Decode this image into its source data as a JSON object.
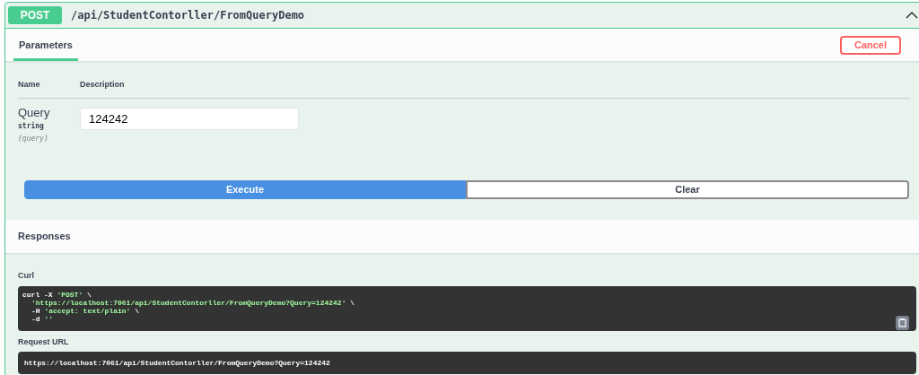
{
  "operation": {
    "method": "POST",
    "path": "/api/StudentContorller/FromQueryDemo",
    "expanded": true
  },
  "tabs": [
    {
      "label": "Parameters",
      "selected": true
    }
  ],
  "cancel_button": "Cancel",
  "parameters_table": {
    "columns": [
      "Name",
      "Description"
    ],
    "rows": [
      {
        "name": "Query",
        "type": "string",
        "location": "(query)",
        "value": "124242"
      }
    ]
  },
  "buttons": [
    {
      "label": "Execute",
      "kind": "primary"
    },
    {
      "label": "Clear",
      "kind": "secondary"
    }
  ],
  "responses": {
    "title": "Responses",
    "curl": {
      "label": "Curl",
      "lines": [
        {
          "indented": false,
          "segments": [
            {
              "kind": "plain",
              "text": "curl -X "
            },
            {
              "kind": "string",
              "text": "'POST'"
            },
            {
              "kind": "plain",
              "text": " \\"
            }
          ]
        },
        {
          "indented": true,
          "segments": [
            {
              "kind": "string",
              "text": "'https://localhost:7061/api/StudentContorller/FromQueryDemo?Query=124242'"
            },
            {
              "kind": "plain",
              "text": " \\"
            }
          ]
        },
        {
          "indented": true,
          "segments": [
            {
              "kind": "plain",
              "text": "-H "
            },
            {
              "kind": "string",
              "text": "'accept: text/plain'"
            },
            {
              "kind": "plain",
              "text": " \\"
            }
          ]
        },
        {
          "indented": true,
          "segments": [
            {
              "kind": "plain",
              "text": "-d "
            },
            {
              "kind": "string",
              "text": "''"
            }
          ]
        }
      ]
    },
    "request_url": {
      "label": "Request URL",
      "value": "https://localhost:7061/api/StudentContorller/FromQueryDemo?Query=124242"
    }
  }
}
